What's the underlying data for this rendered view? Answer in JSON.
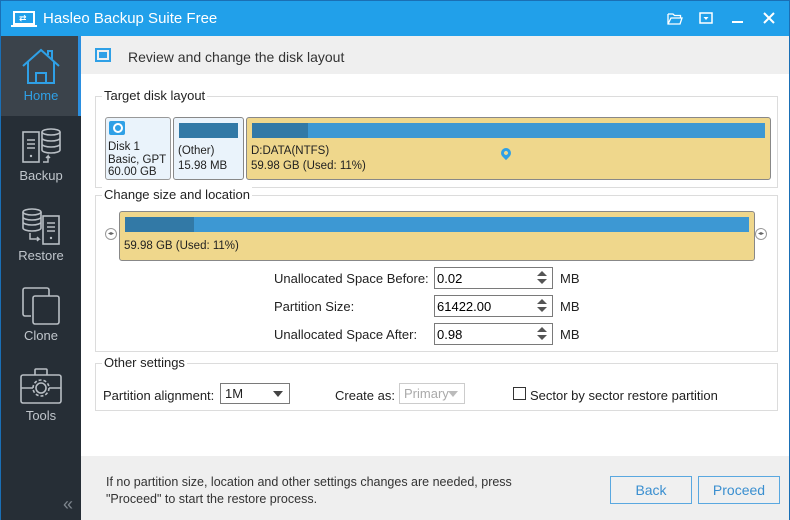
{
  "window": {
    "title": "Hasleo Backup Suite Free",
    "controls": [
      {
        "name": "open-folder-icon",
        "glyph": "🗁"
      },
      {
        "name": "menu-dropdown-icon",
        "glyph": "▾"
      },
      {
        "name": "minimize-icon",
        "glyph": "—"
      },
      {
        "name": "close-icon",
        "glyph": "✕"
      }
    ]
  },
  "sidebar": {
    "items": [
      {
        "label": "Home",
        "icon": "home-icon",
        "active": true
      },
      {
        "label": "Backup",
        "icon": "backup-icon",
        "active": false
      },
      {
        "label": "Restore",
        "icon": "restore-icon",
        "active": false
      },
      {
        "label": "Clone",
        "icon": "clone-icon",
        "active": false
      },
      {
        "label": "Tools",
        "icon": "tools-icon",
        "active": false
      }
    ],
    "collapse_glyph": "«"
  },
  "header": {
    "title": "Review and change the disk layout"
  },
  "target_layout": {
    "title": "Target disk layout",
    "disk": {
      "name": "Disk 1",
      "type": "Basic, GPT",
      "size": "60.00 GB"
    },
    "partitions": [
      {
        "label": "(Other)",
        "size": "15.98 MB",
        "used_fraction": 1.0
      },
      {
        "label": "D:DATA(NTFS)",
        "size": "59.98 GB (Used: 11%)",
        "used_fraction": 0.11
      }
    ]
  },
  "change_size": {
    "title": "Change size and location",
    "bar_label": "59.98 GB (Used: 11%)",
    "used_fraction": 0.11,
    "fields": [
      {
        "label": "Unallocated Space Before:",
        "value": "0.02",
        "unit": "MB"
      },
      {
        "label": "Partition Size:",
        "value": "61422.00",
        "unit": "MB"
      },
      {
        "label": "Unallocated Space After:",
        "value": "0.98",
        "unit": "MB"
      }
    ]
  },
  "other_settings": {
    "title": "Other settings",
    "alignment_label": "Partition alignment:",
    "alignment_value": "1M",
    "create_as_label": "Create as:",
    "create_as_value": "Primary",
    "sector_checkbox_label": "Sector by sector restore partition",
    "sector_checked": false
  },
  "footer": {
    "message": "If no partition size, location and other settings changes are needed, press \"Proceed\" to start the restore process.",
    "back_label": "Back",
    "proceed_label": "Proceed"
  }
}
